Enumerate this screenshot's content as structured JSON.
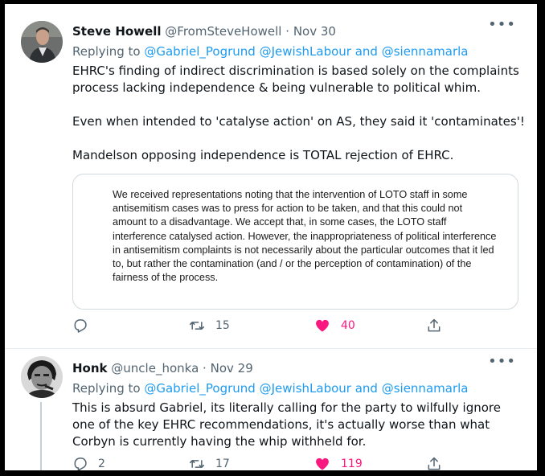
{
  "tweets": [
    {
      "author_name": "Steve Howell",
      "handle": "@FromSteveHowell",
      "separator": "·",
      "date": "Nov 30",
      "replying_prefix": "Replying to ",
      "reply_to_1": "@Gabriel_Pogrund",
      "reply_to_2": "@JewishLabour",
      "reply_and": " and ",
      "reply_to_3": "@siennamarla",
      "text": "EHRC's finding of indirect discrimination is based solely on the complaints process lacking independence & being vulnerable to political whim.\n\nEven when intended to 'catalyse action' on AS, they said it 'contaminates'!\n\nMandelson opposing independence is TOTAL rejection of EHRC.",
      "quote_text": "We received representations noting that the intervention of LOTO staff in some antisemitism cases was to press for action to be taken, and that this could not amount to a disadvantage. We accept that, in some cases, the LOTO staff interference catalysed action. However, the inappropriateness of political interference in antisemitism complaints is not necessarily about the particular outcomes that it led to, but rather the contamination (and / or the perception of contamination) of the fairness of the process.",
      "reply_count": "",
      "retweet_count": "15",
      "like_count": "40",
      "liked": true
    },
    {
      "author_name": "Honk",
      "handle": "@uncle_honka",
      "separator": "·",
      "date": "Nov 29",
      "replying_prefix": "Replying to ",
      "reply_to_1": "@Gabriel_Pogrund",
      "reply_to_2": "@JewishLabour",
      "reply_and": " and ",
      "reply_to_3": "@siennamarla",
      "text": "This is absurd Gabriel, its literally calling for the party to wilfully ignore one of the key EHRC recommendations, it's actually worse than what Corbyn is currently having the whip withheld for.",
      "reply_count": "2",
      "retweet_count": "17",
      "like_count": "119",
      "liked": true
    }
  ],
  "colors": {
    "link": "#1d9bf0",
    "secondary_text": "#536471",
    "like_active": "#f91880"
  },
  "icons": [
    "more-icon",
    "reply-icon",
    "retweet-icon",
    "heart-icon",
    "share-icon"
  ]
}
